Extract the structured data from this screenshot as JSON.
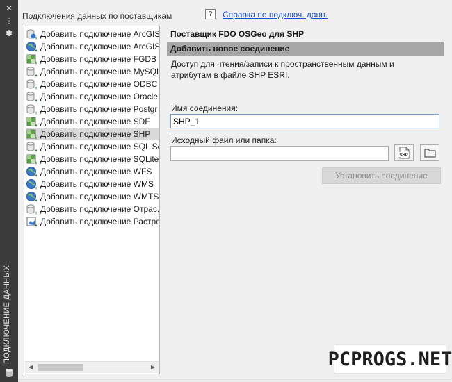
{
  "side_strip": {
    "title": "ПОДКЛЮЧЕНИЕ ДАННЫХ",
    "close_glyph": "✕",
    "pin_glyph": "⫶",
    "settings_glyph": "✱"
  },
  "panel": {
    "header": "Подключения данных по поставщикам",
    "help_icon": "?",
    "help_link": "Справка по подключ. данн."
  },
  "providers": [
    {
      "label": "Добавить подключение ArcGIS",
      "icon": "db-globe-icon"
    },
    {
      "label": "Добавить подключение ArcGIS",
      "icon": "globe-icon"
    },
    {
      "label": "Добавить подключение FGDB",
      "icon": "map-raster-icon"
    },
    {
      "label": "Добавить подключение MySQL",
      "icon": "db-icon"
    },
    {
      "label": "Добавить подключение ODBC",
      "icon": "db-icon"
    },
    {
      "label": "Добавить подключение Oracle",
      "icon": "db-icon"
    },
    {
      "label": "Добавить подключение Postgr",
      "icon": "db-icon"
    },
    {
      "label": "Добавить подключение SDF",
      "icon": "map-raster-icon"
    },
    {
      "label": "Добавить подключение SHP",
      "icon": "map-raster-icon",
      "selected": true
    },
    {
      "label": "Добавить подключение SQL Se",
      "icon": "db-icon"
    },
    {
      "label": "Добавить подключение SQLite",
      "icon": "map-raster-icon"
    },
    {
      "label": "Добавить подключение WFS",
      "icon": "globe-icon"
    },
    {
      "label": "Добавить подключение WMS",
      "icon": "globe-icon"
    },
    {
      "label": "Добавить подключение WMTS",
      "icon": "globe-icon"
    },
    {
      "label": "Добавить подключение Отрас.",
      "icon": "db-icon"
    },
    {
      "label": "Добавить подключение Растро",
      "icon": "raster-icon"
    }
  ],
  "detail": {
    "provider_title": "Поставщик FDO OSGeo для SHP",
    "section_title": "Добавить новое соединение",
    "description": "Доступ для чтения/записи к пространственным данным и атрибутам в файле SHP ESRI.",
    "name_label": "Имя соединения:",
    "name_value": "SHP_1",
    "source_label": "Исходный файл или папка:",
    "source_value": "",
    "shp_button_text": "SHP",
    "connect_button": "Установить соединение"
  },
  "watermark": "PCPROGS.NET",
  "colors": {
    "strip": "#3b3b3b",
    "section_bar": "#a6a6a6",
    "link": "#1a4fcf",
    "selected_row": "#d9d9d9",
    "globe_blue": "#3a78c9",
    "map_green": "#5aa845"
  }
}
